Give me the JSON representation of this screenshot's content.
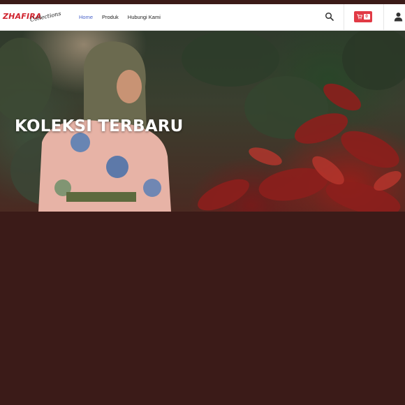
{
  "brand": {
    "name": "ZHAFIRA",
    "tagline": "Collections",
    "color": "#d0232e"
  },
  "nav": {
    "items": [
      {
        "label": "Home",
        "active": true
      },
      {
        "label": "Produk",
        "active": false
      },
      {
        "label": "Hubungi Kami",
        "active": false
      }
    ],
    "active_color": "#4a63c9"
  },
  "header_actions": {
    "search_icon": "search-icon",
    "cart": {
      "icon": "cart-icon",
      "count": "0",
      "color": "#e13a45"
    },
    "user_icon": "user-icon"
  },
  "hero": {
    "title": "KOLEKSI TERBARU"
  },
  "page": {
    "background_color": "#3b1b18"
  }
}
